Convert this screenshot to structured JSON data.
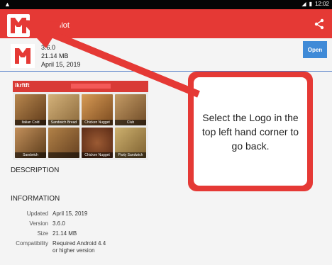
{
  "status": {
    "left_icon": "warning-icon",
    "clock": "12:02"
  },
  "appbar": {
    "title": "Menu Pilot"
  },
  "app": {
    "version": "3.6.0",
    "size": "21.14 MB",
    "date": "April 15, 2019",
    "open_label": "Open"
  },
  "screenshot": {
    "brand": "ikrftft",
    "tiles": [
      "Italian Cold Sandwich",
      "Sandwich Bread",
      "Chicken Nugget",
      "Club",
      "Sandwich",
      "",
      "Chicken Nugget",
      "Party Sandwich"
    ]
  },
  "sections": {
    "description": "DESCRIPTION",
    "information": "INFORMATION"
  },
  "details": [
    {
      "label": "Updated",
      "value": "April 15, 2019"
    },
    {
      "label": "Version",
      "value": "3.6.0"
    },
    {
      "label": "Size",
      "value": "21.14 MB"
    },
    {
      "label": "Compatibility",
      "value": "Required Android 4.4 or higher version"
    }
  ],
  "callout": {
    "text": "Select the Logo in the top left hand corner to go back."
  },
  "colors": {
    "accent": "#e53935",
    "open": "#3f8ad7"
  }
}
